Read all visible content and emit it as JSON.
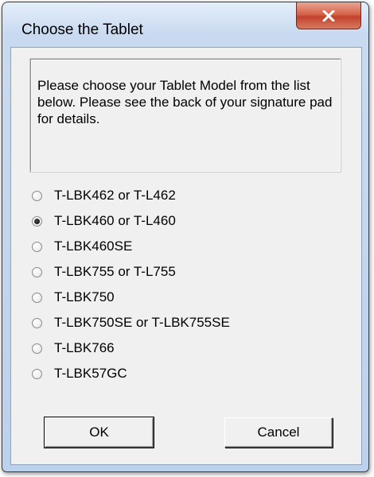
{
  "window": {
    "title": "Choose the Tablet"
  },
  "dialog": {
    "message": "Please choose your Tablet Model from the list below. Please see the back of your signature pad for details.",
    "options": [
      {
        "label": "T-LBK462 or T-L462",
        "checked": false
      },
      {
        "label": "T-LBK460 or T-L460",
        "checked": true
      },
      {
        "label": "T-LBK460SE",
        "checked": false
      },
      {
        "label": "T-LBK755 or T-L755",
        "checked": false
      },
      {
        "label": "T-LBK750",
        "checked": false
      },
      {
        "label": "T-LBK750SE or T-LBK755SE",
        "checked": false
      },
      {
        "label": "T-LBK766",
        "checked": false
      },
      {
        "label": "T-LBK57GC",
        "checked": false
      }
    ],
    "ok_label": "OK",
    "cancel_label": "Cancel"
  },
  "icons": {
    "close": "close-icon"
  },
  "colors": {
    "close_button": "#c4422b",
    "title_bar": "#c9daf0",
    "dialog_face": "#f0f0f0"
  }
}
